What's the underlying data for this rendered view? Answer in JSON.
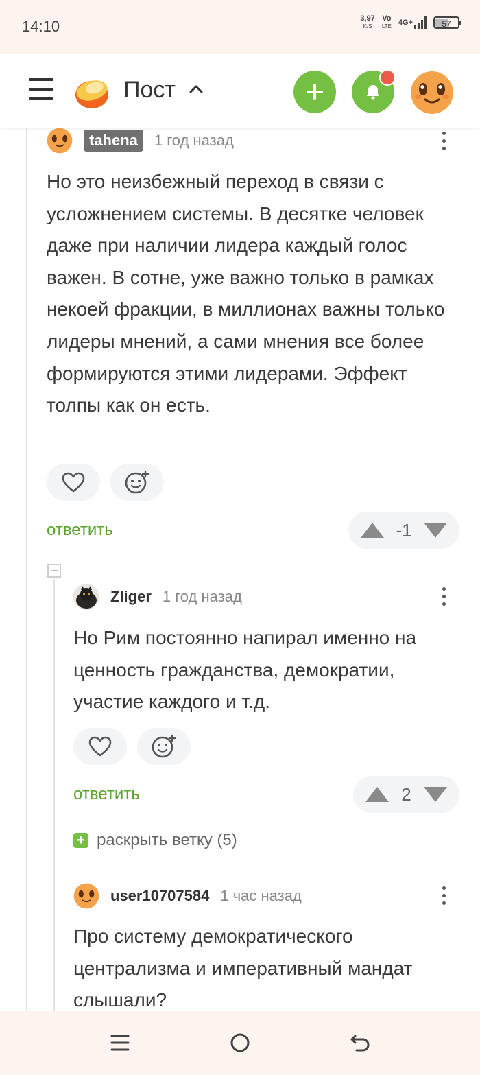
{
  "status_bar": {
    "time": "14:10",
    "net_speed": "3,97",
    "net_unit": "K/S",
    "volte_top": "Vo",
    "volte_bottom": "LTE",
    "network": "4G+",
    "battery": "57"
  },
  "header": {
    "title": "Пост",
    "logo_icon": "pikabu-logo-icon",
    "add_icon": "plus-icon",
    "notifications_icon": "bell-icon",
    "notification_dot_color": "#ee5b4b",
    "accent_color": "#75c043"
  },
  "comments": [
    {
      "author": "tahena",
      "time": "1 год назад",
      "text": "Но это неизбежный переход в связи с усложнением системы. В десятке человек даже при наличии лидера каждый голос важен. В сотне, уже важно только в рамках некоей фракции, в миллионах важны только лидеры мнений, а сами мнения все более формируются этими лидерами. Эффект толпы как он есть.",
      "reply_label": "ответить",
      "rating": "-1"
    },
    {
      "author": "Zliger",
      "time": "1 год назад",
      "text": "Но Рим постоянно напирал именно на ценность гражданства, демократии, участие каждого и т.д.",
      "reply_label": "ответить",
      "rating": "2",
      "expand_label": "раскрыть ветку (5)"
    },
    {
      "author": "user10707584",
      "time": "1 час назад",
      "text": "Про систему демократического централизма и императивный мандат слышали?"
    }
  ],
  "nav_bar": {
    "icons": [
      "menu-icon",
      "home-icon",
      "back-icon"
    ]
  }
}
